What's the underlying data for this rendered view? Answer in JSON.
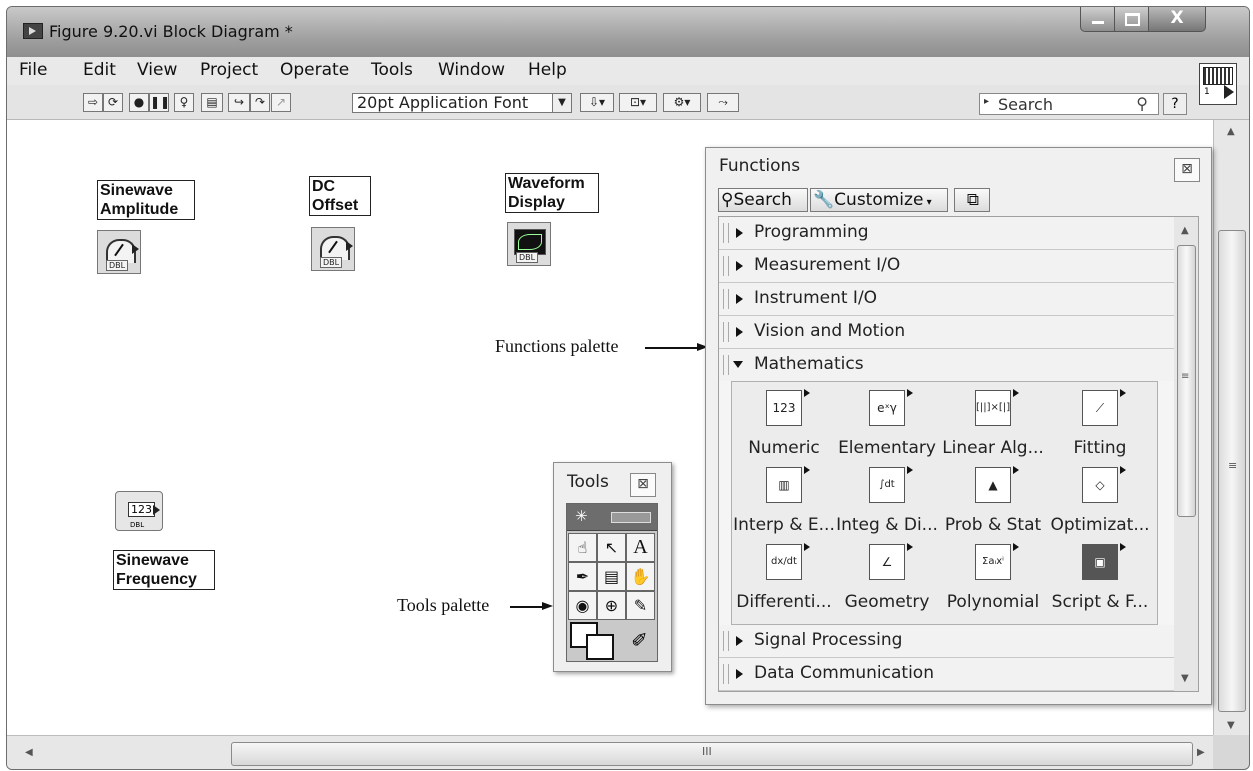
{
  "window": {
    "title": "Figure 9.20.vi Block Diagram *",
    "close_glyph": "X"
  },
  "menu": [
    "File",
    "Edit",
    "View",
    "Project",
    "Operate",
    "Tools",
    "Window",
    "Help"
  ],
  "toolbar": {
    "font": "20pt Application Font",
    "search_placeholder": "Search",
    "help_glyph": "?",
    "corner_icon_number": "1"
  },
  "diagram": {
    "controls": [
      {
        "label": "Sinewave\nAmplitude",
        "dtype": "DBL"
      },
      {
        "label": "DC\nOffset",
        "dtype": "DBL"
      },
      {
        "label": "Waveform\nDisplay",
        "dtype": "DBL"
      },
      {
        "label": "Sinewave\nFrequency",
        "dtype": "DBL",
        "value": "123"
      }
    ],
    "annotations": {
      "functions": "Functions palette",
      "tools": "Tools palette"
    },
    "hscroll_grip": "III"
  },
  "tools_palette": {
    "title": "Tools",
    "close_glyph": "⊠",
    "icons": [
      "automatic-tool-icon",
      "operate-value-icon",
      "position-select-icon",
      "edit-text-icon",
      "connect-wire-icon",
      "shortcut-menu-icon",
      "scroll-window-icon",
      "breakpoint-icon",
      "probe-icon",
      "get-color-icon",
      "set-color-icon",
      "paintbrush-icon"
    ]
  },
  "functions_palette": {
    "title": "Functions",
    "close_glyph": "⊠",
    "search_label": "Search",
    "customize_label": "Customize",
    "categories_top": [
      "Programming",
      "Measurement I/O",
      "Instrument I/O",
      "Vision and Motion"
    ],
    "expanded_category": "Mathematics",
    "subpalettes": [
      {
        "label": "Numeric",
        "icon": "numeric-icon",
        "glyph": "123"
      },
      {
        "label": "Elementary",
        "icon": "elementary-icon",
        "glyph": "eˣγ"
      },
      {
        "label": "Linear Alg...",
        "icon": "linear-algebra-icon",
        "glyph": "[||]×[|]"
      },
      {
        "label": "Fitting",
        "icon": "fitting-icon",
        "glyph": "⟋"
      },
      {
        "label": "Interp & E...",
        "icon": "interpolation-icon",
        "glyph": "▥"
      },
      {
        "label": "Integ & Di...",
        "icon": "integration-icon",
        "glyph": "∫dt"
      },
      {
        "label": "Prob & Stat",
        "icon": "probability-icon",
        "glyph": "▲"
      },
      {
        "label": "Optimizat...",
        "icon": "optimization-icon",
        "glyph": "◇"
      },
      {
        "label": "Differenti...",
        "icon": "differential-icon",
        "glyph": "dx/dt"
      },
      {
        "label": "Geometry",
        "icon": "geometry-icon",
        "glyph": "∠"
      },
      {
        "label": "Polynomial",
        "icon": "polynomial-icon",
        "glyph": "Σaᵢxⁱ"
      },
      {
        "label": "Script & F...",
        "icon": "script-icon",
        "glyph": "▣"
      }
    ],
    "categories_bottom": [
      "Signal Processing",
      "Data Communication"
    ],
    "scroll_grip": "≡"
  }
}
